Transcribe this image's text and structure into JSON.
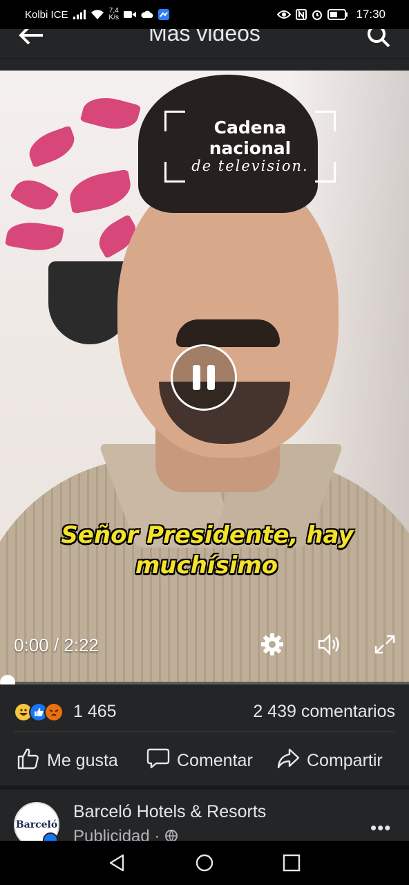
{
  "status_bar": {
    "carrier": "Kolbi ICE",
    "net_speed_value": "7,4",
    "net_speed_unit": "K/s",
    "battery_level": 0.55,
    "time": "17:30"
  },
  "header": {
    "title": "Más videos",
    "back_icon": "arrow-left-icon",
    "search_icon": "search-icon"
  },
  "video": {
    "watermark": {
      "line1": "Cadena",
      "line2": "nacional",
      "line3": "de television."
    },
    "subtitle_line1": "Señor Presidente, hay",
    "subtitle_line2": "muchísimo",
    "time": "0:00 / 2:22",
    "progress": 0.0,
    "controls": [
      "settings-icon",
      "volume-icon",
      "fullscreen-icon"
    ]
  },
  "post": {
    "reactions": [
      "haha",
      "like",
      "angry"
    ],
    "reaction_count": "1 465",
    "comment_count": "2 439 comentarios",
    "actions": {
      "like": "Me gusta",
      "comment": "Comentar",
      "share": "Compartir"
    }
  },
  "ad": {
    "avatar_text": "Barceló",
    "name": "Barceló Hotels & Resorts",
    "sponsored": "Publicidad · ",
    "more": "•••"
  },
  "colors": {
    "panel_bg": "#242526",
    "text_primary": "#e4e6eb",
    "text_secondary": "#b0b3b8",
    "subtitle_yellow": "#f5e22a",
    "facebook_blue": "#1877f2"
  }
}
